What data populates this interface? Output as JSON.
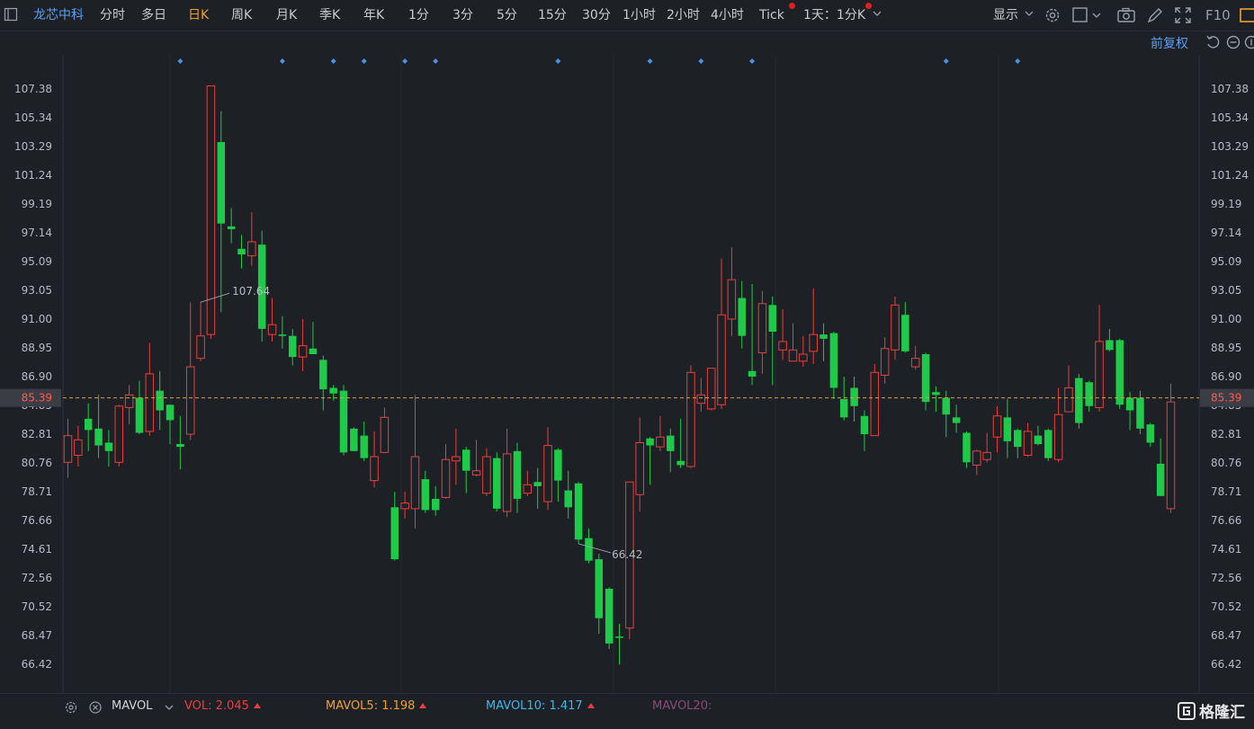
{
  "toolbar": {
    "stock_name": "龙芯中科",
    "periods": [
      "分时",
      "多日",
      "日K",
      "周K",
      "月K",
      "季K",
      "年K",
      "1分",
      "3分",
      "5分",
      "15分",
      "30分",
      "1小时",
      "2小时",
      "4小时",
      "Tick"
    ],
    "active_period": "日K",
    "range_select": "1天：1分K",
    "display_label": "显示",
    "f10_label": "F10"
  },
  "subbar": {
    "adjust_label": "前复权"
  },
  "chart_data": {
    "type": "candlestick",
    "y_ticks": [
      "107.38",
      "105.34",
      "103.29",
      "101.24",
      "99.19",
      "97.14",
      "95.09",
      "93.05",
      "91.00",
      "88.95",
      "86.90",
      "84.85",
      "82.81",
      "80.76",
      "78.71",
      "76.66",
      "74.61",
      "72.56",
      "70.52",
      "68.47",
      "66.42"
    ],
    "ylim": [
      64.5,
      110.0
    ],
    "current_price": "85.39",
    "high_label": "107.64",
    "low_label": "66.42",
    "colors": {
      "up": "#e84040",
      "down": "#1fc94a",
      "current_line": "#d9a23a",
      "marker": "#4f8fe6"
    },
    "marker_indices": [
      11,
      21,
      26,
      29,
      33,
      36,
      48,
      57,
      62,
      67,
      86,
      93
    ],
    "high_index": 13,
    "low_index": 50,
    "candles": [
      {
        "o": 80.8,
        "c": 82.7,
        "h": 83.9,
        "l": 79.7
      },
      {
        "o": 81.3,
        "c": 82.4,
        "h": 83.4,
        "l": 80.5
      },
      {
        "o": 83.9,
        "c": 83.1,
        "h": 85.0,
        "l": 81.6
      },
      {
        "o": 83.2,
        "c": 82.0,
        "h": 85.6,
        "l": 81.1
      },
      {
        "o": 82.2,
        "c": 81.6,
        "h": 83.1,
        "l": 80.5
      },
      {
        "o": 80.8,
        "c": 84.8,
        "h": 84.9,
        "l": 80.5
      },
      {
        "o": 84.7,
        "c": 85.6,
        "h": 86.3,
        "l": 83.5
      },
      {
        "o": 85.4,
        "c": 82.9,
        "h": 86.6,
        "l": 82.8
      },
      {
        "o": 83.0,
        "c": 87.1,
        "h": 89.3,
        "l": 82.7
      },
      {
        "o": 85.9,
        "c": 84.5,
        "h": 87.3,
        "l": 83.1
      },
      {
        "o": 84.9,
        "c": 83.8,
        "h": 84.9,
        "l": 82.1
      },
      {
        "o": 82.1,
        "c": 81.9,
        "h": 84.1,
        "l": 80.3
      },
      {
        "o": 82.8,
        "c": 87.6,
        "h": 92.2,
        "l": 82.4
      },
      {
        "o": 88.2,
        "c": 89.8,
        "h": 92.2,
        "l": 88.0
      },
      {
        "o": 89.9,
        "c": 107.6,
        "h": 107.6,
        "l": 89.6
      },
      {
        "o": 103.6,
        "c": 97.8,
        "h": 105.8,
        "l": 91.5
      },
      {
        "o": 97.6,
        "c": 97.4,
        "h": 98.9,
        "l": 96.4
      },
      {
        "o": 96.0,
        "c": 95.6,
        "h": 97.0,
        "l": 94.6
      },
      {
        "o": 95.5,
        "c": 96.5,
        "h": 98.6,
        "l": 94.8
      },
      {
        "o": 96.3,
        "c": 90.3,
        "h": 97.3,
        "l": 89.4
      },
      {
        "o": 89.9,
        "c": 90.6,
        "h": 92.5,
        "l": 89.4
      },
      {
        "o": 89.9,
        "c": 89.8,
        "h": 91.2,
        "l": 88.9
      },
      {
        "o": 89.8,
        "c": 88.3,
        "h": 90.3,
        "l": 87.7
      },
      {
        "o": 88.3,
        "c": 89.1,
        "h": 91.0,
        "l": 87.3
      },
      {
        "o": 88.9,
        "c": 88.5,
        "h": 90.8,
        "l": 88.5
      },
      {
        "o": 88.1,
        "c": 86.0,
        "h": 88.4,
        "l": 84.5
      },
      {
        "o": 86.1,
        "c": 85.7,
        "h": 86.3,
        "l": 85.2
      },
      {
        "o": 85.9,
        "c": 81.5,
        "h": 86.3,
        "l": 81.3
      },
      {
        "o": 83.2,
        "c": 81.6,
        "h": 83.3,
        "l": 81.6
      },
      {
        "o": 82.7,
        "c": 81.1,
        "h": 83.7,
        "l": 80.9
      },
      {
        "o": 79.5,
        "c": 81.2,
        "h": 83.0,
        "l": 79.0
      },
      {
        "o": 81.5,
        "c": 84.0,
        "h": 84.7,
        "l": 81.5
      },
      {
        "o": 77.6,
        "c": 73.9,
        "h": 78.7,
        "l": 73.8
      },
      {
        "o": 77.5,
        "c": 77.9,
        "h": 78.7,
        "l": 76.8
      },
      {
        "o": 77.5,
        "c": 81.2,
        "h": 85.6,
        "l": 76.1
      },
      {
        "o": 79.6,
        "c": 77.4,
        "h": 80.2,
        "l": 77.2
      },
      {
        "o": 78.2,
        "c": 77.4,
        "h": 79.1,
        "l": 77.0
      },
      {
        "o": 78.3,
        "c": 81.0,
        "h": 82.1,
        "l": 78.2
      },
      {
        "o": 80.9,
        "c": 81.2,
        "h": 83.2,
        "l": 79.2
      },
      {
        "o": 81.7,
        "c": 80.2,
        "h": 81.9,
        "l": 78.6
      },
      {
        "o": 79.9,
        "c": 80.2,
        "h": 82.4,
        "l": 79.8
      },
      {
        "o": 78.6,
        "c": 81.2,
        "h": 81.8,
        "l": 78.4
      },
      {
        "o": 81.1,
        "c": 77.5,
        "h": 81.5,
        "l": 77.3
      },
      {
        "o": 77.3,
        "c": 81.4,
        "h": 83.2,
        "l": 76.9
      },
      {
        "o": 81.6,
        "c": 78.2,
        "h": 82.2,
        "l": 77.2
      },
      {
        "o": 78.6,
        "c": 79.2,
        "h": 80.2,
        "l": 78.4
      },
      {
        "o": 79.4,
        "c": 79.1,
        "h": 80.4,
        "l": 77.5
      },
      {
        "o": 78.0,
        "c": 82.0,
        "h": 83.3,
        "l": 77.4
      },
      {
        "o": 81.7,
        "c": 79.5,
        "h": 81.8,
        "l": 78.0
      },
      {
        "o": 78.8,
        "c": 77.6,
        "h": 80.2,
        "l": 76.8
      },
      {
        "o": 79.3,
        "c": 75.3,
        "h": 79.4,
        "l": 75.0
      },
      {
        "o": 75.4,
        "c": 73.8,
        "h": 76.1,
        "l": 73.6
      },
      {
        "o": 73.9,
        "c": 69.7,
        "h": 74.3,
        "l": 68.6
      },
      {
        "o": 71.8,
        "c": 67.9,
        "h": 71.9,
        "l": 67.5
      },
      {
        "o": 68.4,
        "c": 68.3,
        "h": 69.3,
        "l": 66.4
      },
      {
        "o": 69.0,
        "c": 79.4,
        "h": 79.4,
        "l": 68.2
      },
      {
        "o": 78.5,
        "c": 82.2,
        "h": 84.0,
        "l": 77.3
      },
      {
        "o": 82.5,
        "c": 82.0,
        "h": 82.6,
        "l": 79.2
      },
      {
        "o": 81.9,
        "c": 82.6,
        "h": 84.1,
        "l": 81.6
      },
      {
        "o": 82.7,
        "c": 81.6,
        "h": 83.2,
        "l": 80.1
      },
      {
        "o": 80.9,
        "c": 80.6,
        "h": 83.9,
        "l": 80.4
      },
      {
        "o": 80.5,
        "c": 87.2,
        "h": 87.7,
        "l": 80.4
      },
      {
        "o": 85.0,
        "c": 85.6,
        "h": 86.8,
        "l": 84.4
      },
      {
        "o": 84.6,
        "c": 87.5,
        "h": 87.5,
        "l": 84.5
      },
      {
        "o": 84.9,
        "c": 91.3,
        "h": 95.3,
        "l": 84.6
      },
      {
        "o": 91.0,
        "c": 93.8,
        "h": 96.1,
        "l": 89.8
      },
      {
        "o": 92.5,
        "c": 89.8,
        "h": 93.7,
        "l": 88.9
      },
      {
        "o": 87.3,
        "c": 86.9,
        "h": 93.5,
        "l": 86.3
      },
      {
        "o": 88.6,
        "c": 92.1,
        "h": 93.0,
        "l": 87.1
      },
      {
        "o": 92.0,
        "c": 90.1,
        "h": 92.6,
        "l": 86.3
      },
      {
        "o": 88.8,
        "c": 89.4,
        "h": 91.7,
        "l": 88.1
      },
      {
        "o": 88.0,
        "c": 88.8,
        "h": 90.7,
        "l": 88.0
      },
      {
        "o": 88.0,
        "c": 88.5,
        "h": 89.8,
        "l": 87.6
      },
      {
        "o": 88.7,
        "c": 89.9,
        "h": 93.2,
        "l": 87.8
      },
      {
        "o": 89.9,
        "c": 89.6,
        "h": 90.7,
        "l": 88.0
      },
      {
        "o": 90.0,
        "c": 86.1,
        "h": 90.1,
        "l": 85.3
      },
      {
        "o": 85.3,
        "c": 84.0,
        "h": 86.9,
        "l": 83.8
      },
      {
        "o": 86.1,
        "c": 84.8,
        "h": 86.9,
        "l": 83.7
      },
      {
        "o": 84.1,
        "c": 82.8,
        "h": 84.5,
        "l": 81.6
      },
      {
        "o": 82.7,
        "c": 87.2,
        "h": 87.8,
        "l": 82.7
      },
      {
        "o": 87.0,
        "c": 88.9,
        "h": 89.7,
        "l": 86.4
      },
      {
        "o": 88.8,
        "c": 92.0,
        "h": 92.6,
        "l": 88.1
      },
      {
        "o": 91.3,
        "c": 88.7,
        "h": 92.2,
        "l": 88.6
      },
      {
        "o": 87.6,
        "c": 88.2,
        "h": 89.1,
        "l": 87.4
      },
      {
        "o": 88.5,
        "c": 85.1,
        "h": 88.6,
        "l": 84.5
      },
      {
        "o": 85.8,
        "c": 85.6,
        "h": 86.2,
        "l": 84.4
      },
      {
        "o": 85.4,
        "c": 84.2,
        "h": 85.9,
        "l": 82.6
      },
      {
        "o": 84.0,
        "c": 83.6,
        "h": 84.9,
        "l": 82.9
      },
      {
        "o": 82.9,
        "c": 80.8,
        "h": 83.0,
        "l": 80.4
      },
      {
        "o": 80.6,
        "c": 81.6,
        "h": 81.7,
        "l": 79.9
      },
      {
        "o": 81.0,
        "c": 81.5,
        "h": 82.9,
        "l": 80.8
      },
      {
        "o": 82.6,
        "c": 84.1,
        "h": 84.8,
        "l": 81.5
      },
      {
        "o": 84.0,
        "c": 82.3,
        "h": 85.3,
        "l": 81.1
      },
      {
        "o": 83.1,
        "c": 81.9,
        "h": 83.2,
        "l": 81.1
      },
      {
        "o": 81.3,
        "c": 83.0,
        "h": 83.6,
        "l": 81.2
      },
      {
        "o": 82.7,
        "c": 82.1,
        "h": 83.4,
        "l": 82.0
      },
      {
        "o": 83.1,
        "c": 81.1,
        "h": 83.2,
        "l": 80.9
      },
      {
        "o": 81.0,
        "c": 84.2,
        "h": 86.1,
        "l": 80.8
      },
      {
        "o": 84.4,
        "c": 86.1,
        "h": 87.7,
        "l": 84.4
      },
      {
        "o": 86.8,
        "c": 83.6,
        "h": 87.1,
        "l": 83.2
      },
      {
        "o": 86.5,
        "c": 84.8,
        "h": 86.6,
        "l": 84.4
      },
      {
        "o": 84.7,
        "c": 89.4,
        "h": 92.0,
        "l": 84.4
      },
      {
        "o": 89.5,
        "c": 88.8,
        "h": 90.3,
        "l": 88.7
      },
      {
        "o": 89.5,
        "c": 84.9,
        "h": 89.6,
        "l": 84.6
      },
      {
        "o": 85.4,
        "c": 84.5,
        "h": 85.8,
        "l": 83.1
      },
      {
        "o": 85.4,
        "c": 83.2,
        "h": 85.9,
        "l": 82.8
      },
      {
        "o": 83.5,
        "c": 82.2,
        "h": 83.6,
        "l": 81.9
      },
      {
        "o": 80.7,
        "c": 78.4,
        "h": 82.5,
        "l": 78.4
      },
      {
        "o": 77.5,
        "c": 85.1,
        "h": 86.4,
        "l": 77.2
      }
    ]
  },
  "bottom": {
    "indicator_name": "MAVOL",
    "vol": {
      "label": "VOL: 2.045",
      "color": "#e84040"
    },
    "mavol5": {
      "label": "MAVOL5: 1.198",
      "color": "#f0a030"
    },
    "mavol10": {
      "label": "MAVOL10: 1.417",
      "color": "#3fb6ea"
    },
    "mavol20": {
      "label": "MAVOL20:",
      "color": "#8a4a7a"
    },
    "logo_text": "格隆汇"
  }
}
